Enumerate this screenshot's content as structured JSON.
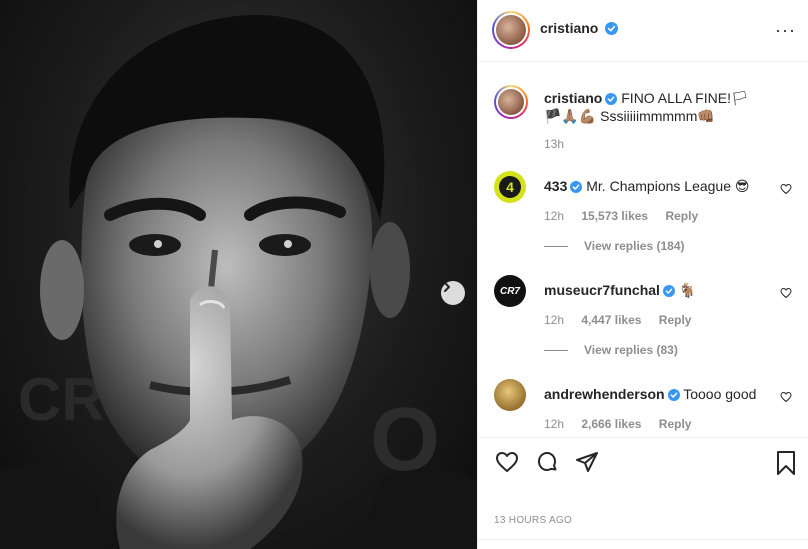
{
  "post": {
    "author": "cristiano",
    "verified": true
  },
  "caption": {
    "author": "cristiano",
    "text": "FINO ALLA FINE!🏳🏴🙏🏽💪🏽 Sssiiiiimmmmm👊🏽",
    "age": "13h"
  },
  "comments": [
    {
      "author": "433",
      "verified": true,
      "text": "Mr. Champions League 😎",
      "age": "12h",
      "likes": "15,573 likes",
      "reply": "Reply",
      "replies": "View replies (184)",
      "avatar_text": "4",
      "avatar_color": "#d4e21a"
    },
    {
      "author": "museucr7funchal",
      "verified": true,
      "text": "🐐",
      "age": "12h",
      "likes": "4,447 likes",
      "reply": "Reply",
      "replies": "View replies (83)",
      "avatar_text": "CR7",
      "avatar_color": "#111111"
    },
    {
      "author": "andrewhenderson",
      "verified": true,
      "text": "Toooo good",
      "age": "12h",
      "likes": "2,666 likes",
      "reply": "Reply",
      "avatar_color": "#c9a24a"
    }
  ],
  "actions": {
    "like_icon": "heart-outline-icon",
    "comment_icon": "comment-icon",
    "share_icon": "paper-plane-icon",
    "save_icon": "bookmark-icon"
  },
  "timestamp": "13 HOURS AGO",
  "colors": {
    "verified_blue": "#3897f0",
    "muted": "#8e8e8e",
    "text": "#262626"
  }
}
